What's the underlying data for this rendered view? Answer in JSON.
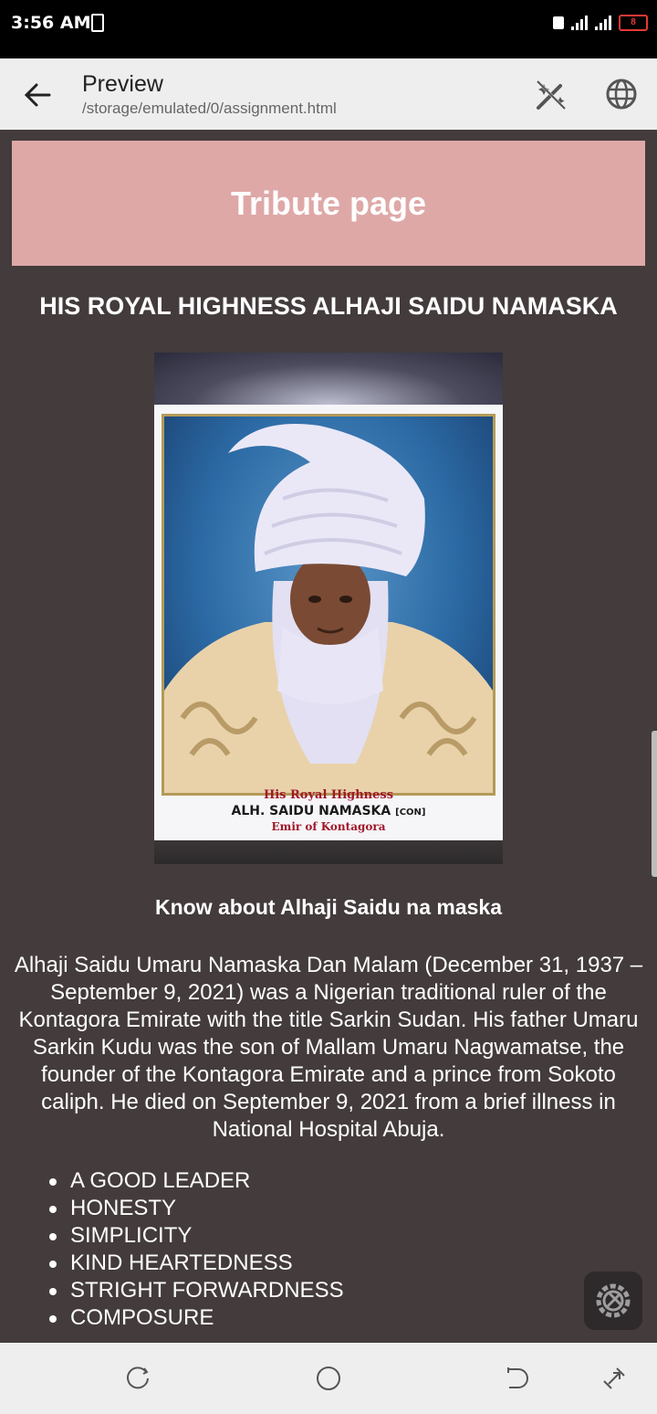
{
  "status_bar": {
    "time": "3:56 AM",
    "battery_level": "8"
  },
  "app_bar": {
    "title": "Preview",
    "path": "/storage/emulated/0/assignment.html",
    "back_icon": "arrow-left-icon",
    "action_icons": [
      "magic-wand-icon",
      "globe-icon"
    ]
  },
  "page": {
    "banner_title": "Tribute page",
    "heading": "HIS ROYAL HIGHNESS ALHAJI SAIDU NAMASKA",
    "photo": {
      "caption_line1": "His Royal Highness",
      "caption_line2": "ALH. SAIDU NAMASKA",
      "caption_suffix": "[CON]",
      "caption_line3": "Emir of Kontagora"
    },
    "subheading": "Know about Alhaji Saidu na maska",
    "paragraph": "Alhaji Saidu Umaru Namaska Dan Malam (December 31, 1937 – September 9, 2021) was a Nigerian traditional ruler of the Kontagora Emirate with the title Sarkin Sudan. His father Umaru Sarkin Kudu was the son of Mallam Umaru Nagwamatse, the founder of the Kontagora Emirate and a prince from Sokoto caliph. He died on September 9, 2021 from a brief illness in National Hospital Abuja.",
    "traits": [
      "A GOOD LEADER",
      "HONESTY",
      "SIMPLICITY",
      "KIND HEARTEDNESS",
      "STRIGHT FORWARDNESS",
      "COMPOSURE"
    ]
  },
  "colors": {
    "background": "#433b3c",
    "banner": "#dea8a7",
    "appbar": "#eeeeee",
    "battery_low": "#e53935"
  }
}
